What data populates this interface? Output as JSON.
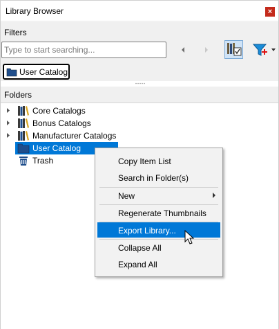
{
  "window": {
    "title": "Library Browser",
    "close_glyph": "×"
  },
  "filters": {
    "label": "Filters",
    "search": {
      "value": "",
      "placeholder": "Type to start searching..."
    },
    "active_chip": {
      "label": "User Catalog",
      "icon": "catalog-folder-icon"
    }
  },
  "folders": {
    "label": "Folders",
    "items": [
      {
        "label": "Core Catalogs",
        "icon": "books-icon",
        "expandable": true,
        "selected": false
      },
      {
        "label": "Bonus Catalogs",
        "icon": "books-icon",
        "expandable": true,
        "selected": false
      },
      {
        "label": "Manufacturer Catalogs",
        "icon": "books-icon",
        "expandable": true,
        "selected": false
      },
      {
        "label": "User Catalog",
        "icon": "catalog-folder-icon",
        "expandable": false,
        "selected": true
      },
      {
        "label": "Trash",
        "icon": "trash-icon",
        "expandable": false,
        "selected": false
      }
    ]
  },
  "context_menu": {
    "items": [
      {
        "label": "Copy Item List"
      },
      {
        "label": "Search in Folder(s)"
      },
      {
        "label": "New",
        "has_submenu": true
      },
      {
        "label": "Regenerate Thumbnails"
      },
      {
        "label": "Export Library...",
        "highlighted": true
      },
      {
        "label": "Collapse All"
      },
      {
        "label": "Expand All"
      }
    ]
  },
  "colors": {
    "selection": "#0078d7",
    "panel_bg": "#f0f0f0",
    "close_red": "#c42b1c",
    "menu_bg": "#f2f2f2"
  }
}
